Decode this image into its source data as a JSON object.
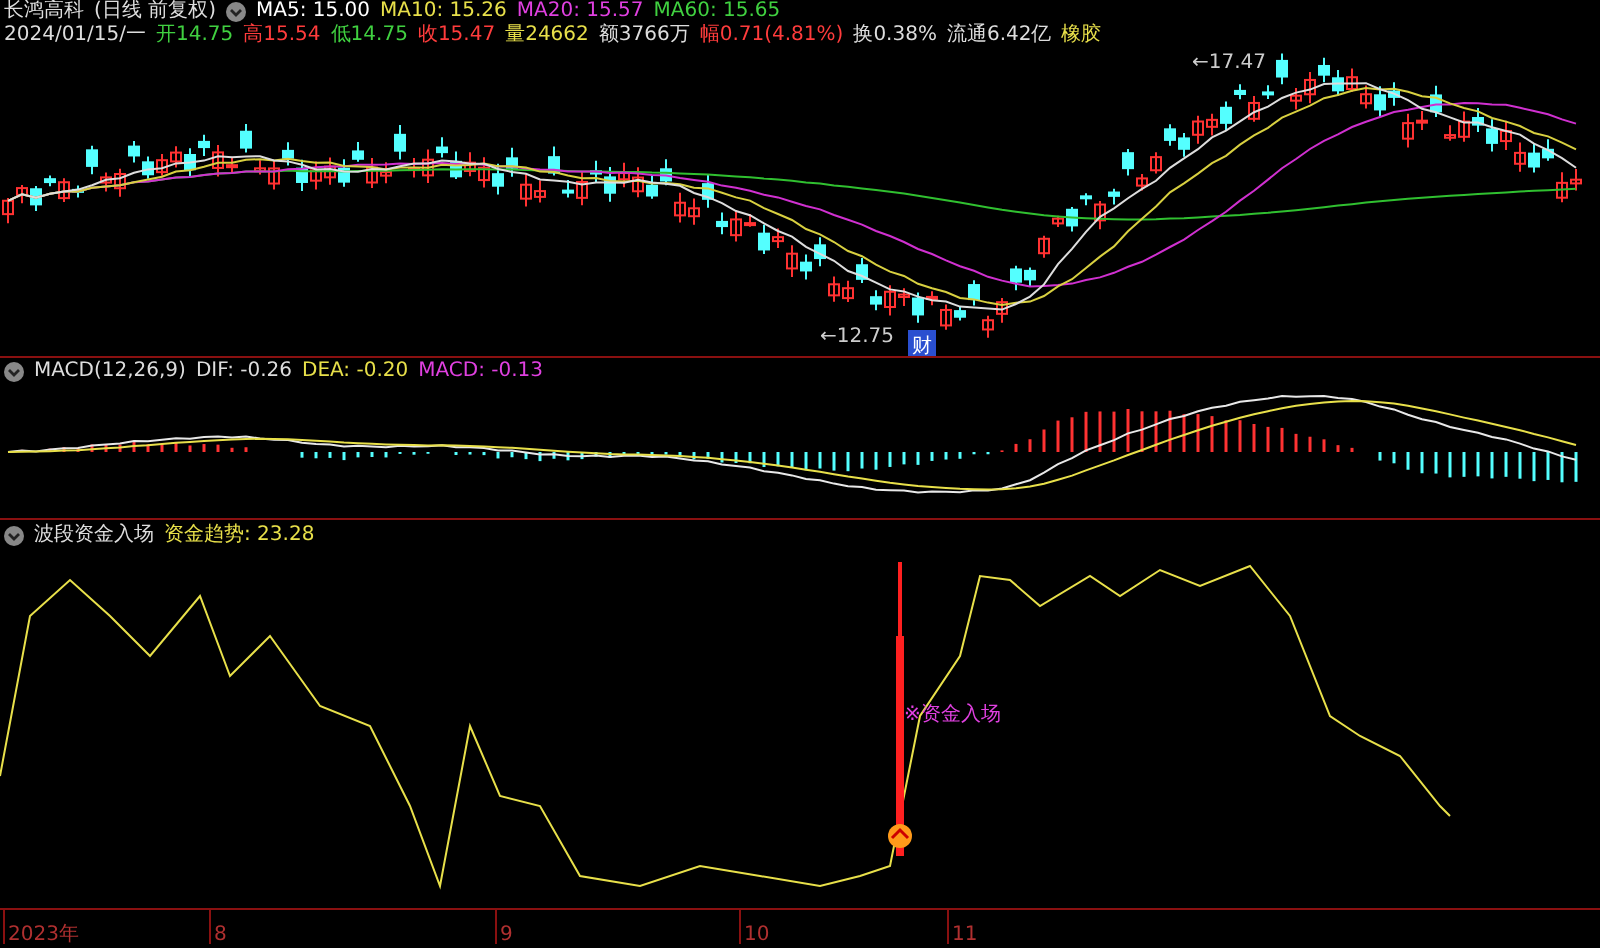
{
  "title_line": {
    "stock_name": "长鸿高科",
    "period": "(日线 前复权)",
    "moving_averages": [
      {
        "label": "MA5: 15.00",
        "color": "#ffffff"
      },
      {
        "label": "MA10: 15.26",
        "color": "#e8e04a"
      },
      {
        "label": "MA20: 15.57",
        "color": "#e040e0"
      },
      {
        "label": "MA60: 15.65",
        "color": "#40d040"
      }
    ]
  },
  "quote_line": {
    "date": "2024/01/15/一",
    "items": [
      {
        "text": "开14.75",
        "color": "#40d040"
      },
      {
        "text": "高15.54",
        "color": "#ff3c3c"
      },
      {
        "text": "低14.75",
        "color": "#40d040"
      },
      {
        "text": "收15.47",
        "color": "#ff3c3c"
      },
      {
        "text": "量24662",
        "color": "#e8e04a"
      },
      {
        "text": "额3766万",
        "color": "#dddddd"
      },
      {
        "text": "幅0.71(4.81%)",
        "color": "#ff3c3c"
      },
      {
        "text": "换0.38%",
        "color": "#dddddd"
      },
      {
        "text": "流通6.42亿",
        "color": "#dddddd"
      },
      {
        "text": "橡胶",
        "color": "#e8e04a"
      }
    ]
  },
  "price_chart": {
    "high_label": "←17.47",
    "low_label": "←12.75",
    "event_badge": "财"
  },
  "macd_panel": {
    "items": [
      {
        "text": "MACD(12,26,9)",
        "color": "#dddddd"
      },
      {
        "text": "DIF: -0.26",
        "color": "#dddddd"
      },
      {
        "text": "DEA: -0.20",
        "color": "#e8e04a"
      },
      {
        "text": "MACD: -0.13",
        "color": "#e040e0"
      }
    ]
  },
  "indicator_panel": {
    "items": [
      {
        "text": "波段资金入场",
        "color": "#dddddd"
      },
      {
        "text": "资金趋势: 23.28",
        "color": "#e8e04a"
      }
    ],
    "signal_label": "※资金入场"
  },
  "time_axis": [
    "2023年",
    "8",
    "9",
    "10",
    "11"
  ]
}
